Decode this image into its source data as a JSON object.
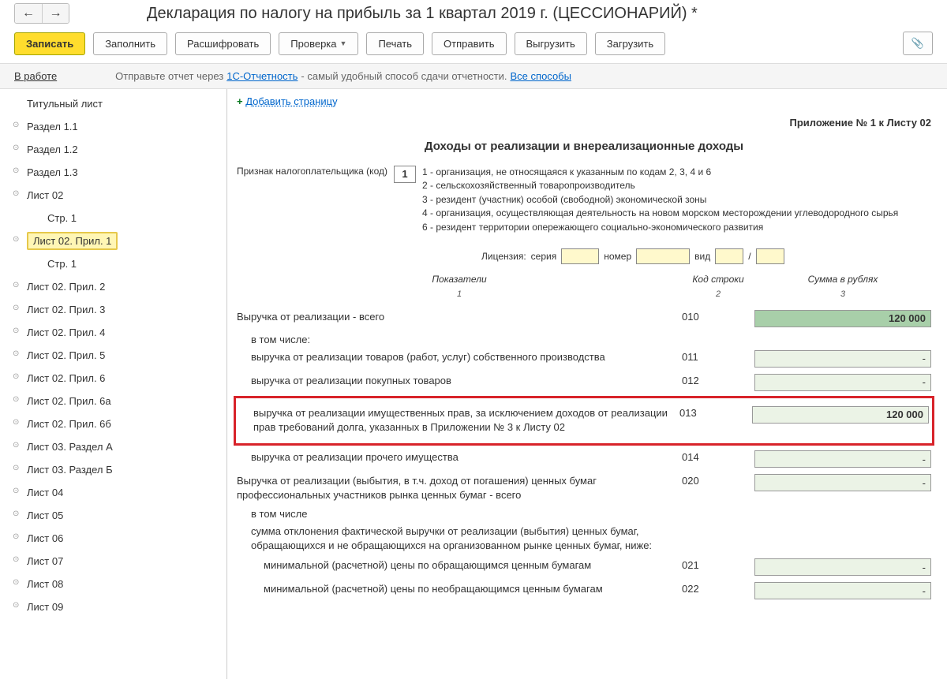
{
  "header": {
    "title": "Декларация по налогу на прибыль за 1 квартал 2019 г. (ЦЕССИОНАРИЙ) *"
  },
  "toolbar": {
    "save": "Записать",
    "fill": "Заполнить",
    "decode": "Расшифровать",
    "check": "Проверка",
    "print": "Печать",
    "send": "Отправить",
    "upload": "Выгрузить",
    "download": "Загрузить"
  },
  "status": {
    "lead": "В работе",
    "text1": "Отправьте отчет через ",
    "link1": "1С-Отчетность",
    "text2": " - самый удобный способ сдачи отчетности. ",
    "link2": "Все способы"
  },
  "sidebar": {
    "items": [
      {
        "label": "Титульный лист",
        "lvl": 1,
        "noicon": true
      },
      {
        "label": "Раздел 1.1",
        "lvl": 1
      },
      {
        "label": "Раздел 1.2",
        "lvl": 1
      },
      {
        "label": "Раздел 1.3",
        "lvl": 1
      },
      {
        "label": "Лист 02",
        "lvl": 1
      },
      {
        "label": "Стр. 1",
        "lvl": 2
      },
      {
        "label": "Лист 02. Прил. 1",
        "lvl": 1,
        "active": true
      },
      {
        "label": "Стр. 1",
        "lvl": 2
      },
      {
        "label": "Лист 02. Прил. 2",
        "lvl": 1
      },
      {
        "label": "Лист 02. Прил. 3",
        "lvl": 1
      },
      {
        "label": "Лист 02. Прил. 4",
        "lvl": 1
      },
      {
        "label": "Лист 02. Прил. 5",
        "lvl": 1
      },
      {
        "label": "Лист 02. Прил. 6",
        "lvl": 1
      },
      {
        "label": "Лист 02. Прил. 6а",
        "lvl": 1
      },
      {
        "label": "Лист 02. Прил. 6б",
        "lvl": 1
      },
      {
        "label": "Лист 03. Раздел А",
        "lvl": 1
      },
      {
        "label": "Лист 03. Раздел Б",
        "lvl": 1
      },
      {
        "label": "Лист 04",
        "lvl": 1
      },
      {
        "label": "Лист 05",
        "lvl": 1
      },
      {
        "label": "Лист 06",
        "lvl": 1
      },
      {
        "label": "Лист 07",
        "lvl": 1
      },
      {
        "label": "Лист 08",
        "lvl": 1
      },
      {
        "label": "Лист 09",
        "lvl": 1
      }
    ]
  },
  "form": {
    "add_page": "Добавить страницу",
    "appendix": "Приложение № 1 к Листу 02",
    "title": "Доходы от реализации и внереализационные доходы",
    "taxpayer_label": "Признак налогоплательщика (код)",
    "taxpayer_code": "1",
    "codes": {
      "c1": "1 - организация, не относящаяся к указанным по кодам 2, 3, 4 и 6",
      "c2": "2 - сельскохозяйственный товаропроизводитель",
      "c3": "3 - резидент (участник) особой (свободной) экономической зоны",
      "c4": "4 - организация, осуществляющая деятельность на новом морском месторождении углеводородного сырья",
      "c6": "6 - резидент территории опережающего социально-экономического развития"
    },
    "license": {
      "label": "Лицензия:",
      "series": "серия",
      "number": "номер",
      "type": "вид"
    },
    "col_heads": {
      "c1": "Показатели",
      "c2": "Код строки",
      "c3": "Сумма в рублях"
    },
    "rows": {
      "r010": {
        "desc": "Выручка от реализации - всего",
        "code": "010",
        "val": "120 000"
      },
      "incl": "в том числе:",
      "r011": {
        "desc": "выручка от реализации товаров (работ, услуг) собственного производства",
        "code": "011"
      },
      "r012": {
        "desc": "выручка от реализации покупных товаров",
        "code": "012"
      },
      "r013": {
        "desc": "выручка от реализации имущественных прав, за исключением доходов от реализации прав требований долга, указанных в Приложении № 3 к Листу 02",
        "code": "013",
        "val": "120 000"
      },
      "r014": {
        "desc": "выручка от реализации прочего имущества",
        "code": "014"
      },
      "r020": {
        "desc": "Выручка от реализации (выбытия, в т.ч. доход от погашения) ценных бумаг профессиональных участников рынка ценных бумаг - всего",
        "code": "020"
      },
      "incl2": "в том числе",
      "r020sub": {
        "desc": "сумма отклонения фактической выручки от реализации (выбытия) ценных бумаг, обращающихся и не обращающихся на организованном рынке ценных бумаг, ниже:"
      },
      "r021": {
        "desc": "минимальной (расчетной) цены по обращающимся ценным бумагам",
        "code": "021"
      },
      "r022": {
        "desc": "минимальной (расчетной) цены по необращающимся ценным бумагам",
        "code": "022"
      }
    }
  }
}
